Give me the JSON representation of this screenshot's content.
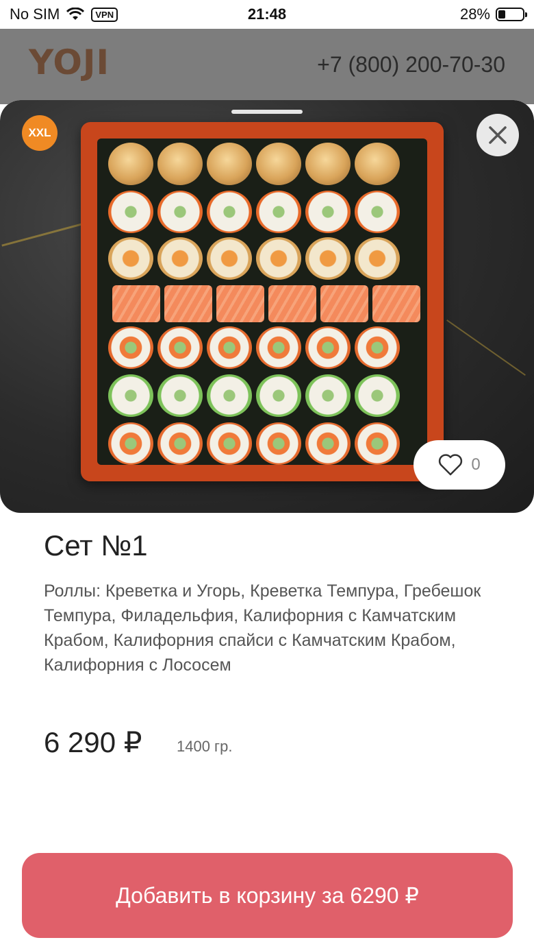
{
  "status_bar": {
    "carrier": "No SIM",
    "vpn": "VPN",
    "time": "21:48",
    "battery_percent": "28%",
    "battery_level": 0.28
  },
  "header": {
    "logo": "YOJI",
    "phone": "+7 (800) 200-70-30"
  },
  "product": {
    "badge": "XXL",
    "likes": "0",
    "title": "Сет №1",
    "description": "Роллы: Креветка и Угорь, Креветка Темпура, Гребешок Темпура, Филадельфия, Калифорния с Камчатским Крабом, Калифорния спайси с Камчатским Крабом, Калифорния с Лососем",
    "price": "6 290 ₽",
    "weight": "1400 гр."
  },
  "actions": {
    "add_to_cart": "Добавить в корзину за 6290 ₽"
  },
  "colors": {
    "accent": "#e0606a",
    "badge": "#f08a24"
  },
  "icons": {
    "close": "close-icon",
    "like": "heart-icon",
    "wifi": "wifi-icon"
  }
}
